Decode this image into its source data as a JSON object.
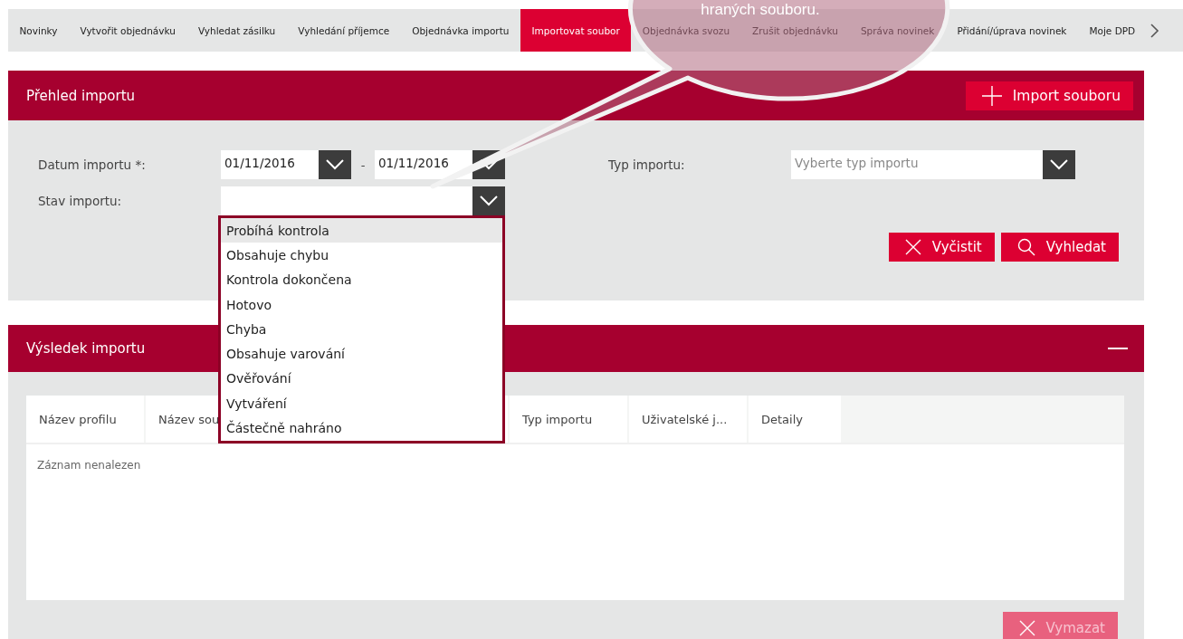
{
  "tabs": [
    {
      "label": "Novinky",
      "selected": false
    },
    {
      "label": "Vytvořit objednávku",
      "selected": false
    },
    {
      "label": "Vyhledat zásilku",
      "selected": false
    },
    {
      "label": "Vyhledání příjemce",
      "selected": false
    },
    {
      "label": "Objednávka importu",
      "selected": false
    },
    {
      "label": "Importovat soubor",
      "selected": true
    },
    {
      "label": "Objednávka svozu",
      "selected": false
    },
    {
      "label": "Zrušit objednávku",
      "selected": false
    },
    {
      "label": "Správa novinek",
      "selected": false
    },
    {
      "label": "Přidání/úprava novinek",
      "selected": false
    },
    {
      "label": "Moje DPD",
      "selected": false
    }
  ],
  "callout": {
    "text": "hraných souboru."
  },
  "overview": {
    "title": "Přehled importu",
    "import_button": "Import souboru",
    "date_label": "Datum importu *:",
    "date_from": "01/11/2016",
    "date_separator": "-",
    "date_to": "01/11/2016",
    "type_label": "Typ importu:",
    "type_placeholder": "Vyberte typ importu",
    "status_label": "Stav importu:",
    "status_options": [
      {
        "label": "Probíhá kontrola",
        "selected": true
      },
      {
        "label": "Obsahuje chybu",
        "selected": false
      },
      {
        "label": "Kontrola dokončena",
        "selected": false
      },
      {
        "label": "Hotovo",
        "selected": false
      },
      {
        "label": "Chyba",
        "selected": false
      },
      {
        "label": "Obsahuje varování",
        "selected": false
      },
      {
        "label": "Ověřování",
        "selected": false
      },
      {
        "label": "Vytváření",
        "selected": false
      },
      {
        "label": "Částečně nahráno",
        "selected": false
      }
    ],
    "clear_button": "Vyčistit",
    "search_button": "Vyhledat"
  },
  "results": {
    "title": "Výsledek importu",
    "table": {
      "columns": [
        "Název profilu",
        "Název sou",
        "Typ importu",
        "Uživatelské j...",
        "Detaily"
      ],
      "empty_text": "Záznam nenalezen"
    },
    "delete_button": {
      "label": "Vymazat",
      "disabled": true
    }
  }
}
